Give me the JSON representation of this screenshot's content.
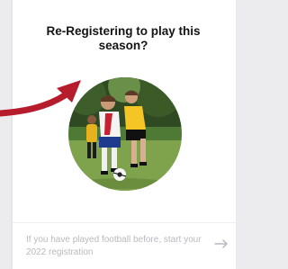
{
  "dialog": {
    "title": "Re-Registering to play this\nseason?",
    "image_alt": "Children playing football",
    "footer_link": {
      "text": "If you have played football before, start your 2022 registration",
      "icon": "arrow-right-icon"
    }
  },
  "colors": {
    "accent": "#b71c2c",
    "title": "#141414",
    "footer_text": "#b9b9c0"
  }
}
